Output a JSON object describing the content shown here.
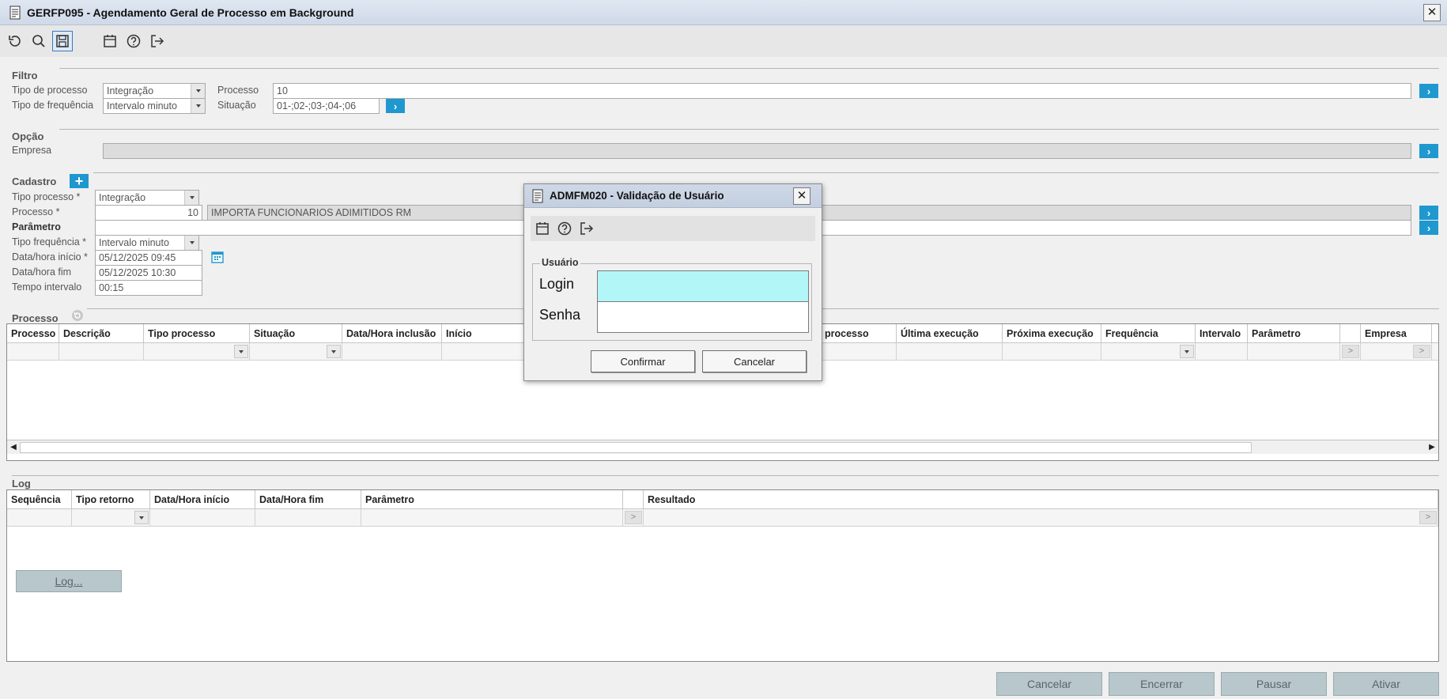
{
  "window": {
    "title": "GERFP095 - Agendamento Geral de Processo em Background",
    "close": "✕"
  },
  "filtro": {
    "title": "Filtro",
    "tipo_processo_label": "Tipo de processo",
    "tipo_processo_value": "Integração",
    "tipo_frequencia_label": "Tipo de frequência",
    "tipo_frequencia_value": "Intervalo minuto",
    "processo_label": "Processo",
    "processo_value": "10",
    "situacao_label": "Situação",
    "situacao_value": "01-;02-;03-;04-;06"
  },
  "opcao": {
    "title": "Opção",
    "empresa_label": "Empresa",
    "empresa_value": ""
  },
  "cadastro": {
    "title": "Cadastro",
    "tipo_processo_label": "Tipo processo *",
    "tipo_processo_value": "Integração",
    "processo_label": "Processo *",
    "processo_value": "10",
    "processo_desc": "IMPORTA FUNCIONARIOS ADIMITIDOS RM",
    "parametro_label": "Parâmetro",
    "parametro_value": "",
    "tipo_frequencia_label": "Tipo frequência *",
    "tipo_frequencia_value": "Intervalo minuto",
    "data_inicio_label": "Data/hora início *",
    "data_inicio_value": "05/12/2025 09:45",
    "data_fim_label": "Data/hora fim",
    "data_fim_value": "05/12/2025 10:30",
    "tempo_label": "Tempo intervalo",
    "tempo_value": "00:15"
  },
  "processo_grid": {
    "title": "Processo",
    "columns": [
      "Processo",
      "Descrição",
      "Tipo processo",
      "Situação",
      "Data/Hora inclusão",
      "Início",
      "processo",
      "Última execução",
      "Próxima execução",
      "Frequência",
      "Intervalo",
      "Parâmetro",
      "",
      "Empresa"
    ]
  },
  "log": {
    "title": "Log",
    "columns": [
      "Sequência",
      "Tipo retorno",
      "Data/Hora início",
      "Data/Hora fim",
      "Parâmetro",
      "",
      "Resultado"
    ],
    "log_button": "Log..."
  },
  "footer": {
    "cancelar": "Cancelar",
    "encerrar": "Encerrar",
    "pausar": "Pausar",
    "ativar": "Ativar"
  },
  "dialog": {
    "title": "ADMFM020 - Validação de Usuário",
    "close": "✕",
    "group_label": "Usuário",
    "login_label": "Login",
    "login_value": "",
    "senha_label": "Senha",
    "senha_value": "",
    "confirmar": "Confirmar",
    "cancelar": "Cancelar"
  },
  "colors": {
    "accent": "#1f98cf",
    "login_focus": "#b3f6f7",
    "disabled_button": "#b8c7cb"
  }
}
